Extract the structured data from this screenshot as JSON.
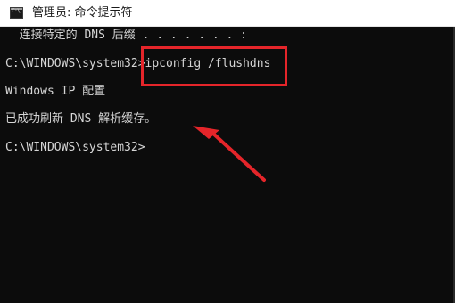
{
  "window": {
    "title": "管理员: 命令提示符",
    "icon": "cmd-icon",
    "icon_text": "C:\\"
  },
  "console": {
    "lines": [
      "  连接特定的 DNS 后缀 . . . . . . . :",
      "C:\\WINDOWS\\system32>ipconfig /flushdns",
      "Windows IP 配置",
      "已成功刷新 DNS 解析缓存。",
      "C:\\WINDOWS\\system32>"
    ]
  },
  "annotation": {
    "highlight_color": "#e5252a",
    "arrow_color": "#e5252a"
  }
}
